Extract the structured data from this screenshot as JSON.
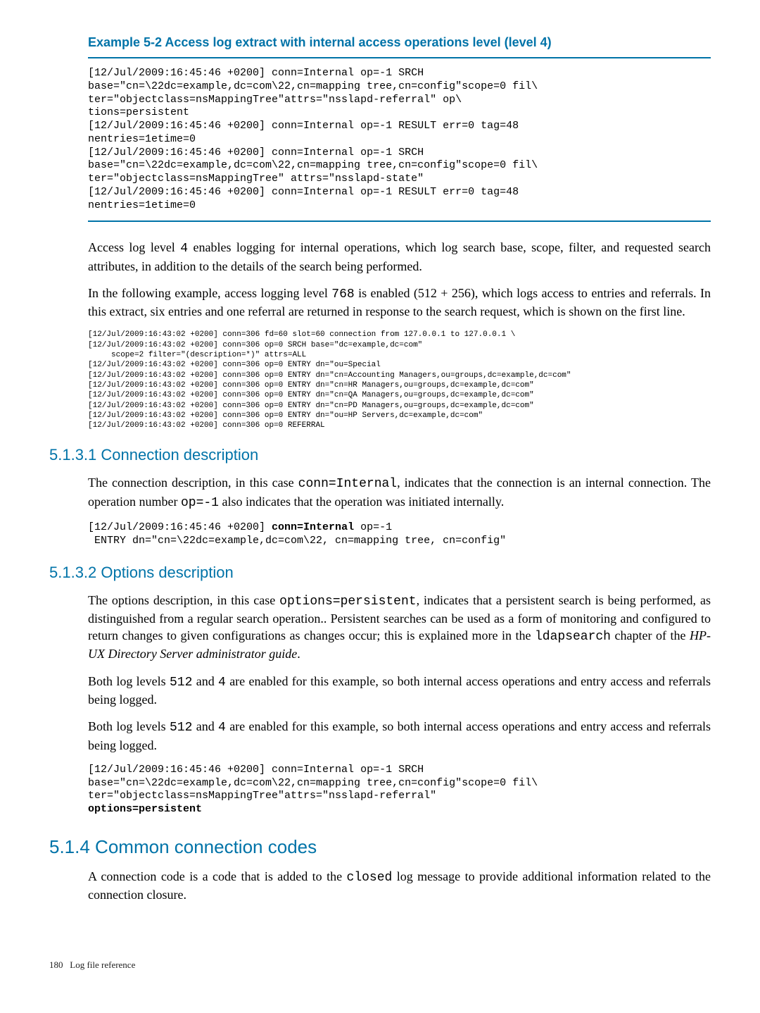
{
  "example": {
    "title": "Example 5-2 Access log extract with internal access operations level (level 4)",
    "code": "[12/Jul/2009:16:45:46 +0200] conn=Internal op=-1 SRCH\nbase=\"cn=\\22dc=example,dc=com\\22,cn=mapping tree,cn=config\"scope=0 fil\\\nter=\"objectclass=nsMappingTree\"attrs=\"nsslapd-referral\" op\\\ntions=persistent\n[12/Jul/2009:16:45:46 +0200] conn=Internal op=-1 RESULT err=0 tag=48\nnentries=1etime=0\n[12/Jul/2009:16:45:46 +0200] conn=Internal op=-1 SRCH\nbase=\"cn=\\22dc=example,dc=com\\22,cn=mapping tree,cn=config\"scope=0 fil\\\nter=\"objectclass=nsMappingTree\" attrs=\"nsslapd-state\"\n[12/Jul/2009:16:45:46 +0200] conn=Internal op=-1 RESULT err=0 tag=48\nnentries=1etime=0"
  },
  "para1a": "Access log level ",
  "para1code": "4",
  "para1b": " enables logging for internal operations, which log search base, scope, filter, and requested search attributes, in addition to the details of the search being performed.",
  "para2a": "In the following example, access logging level ",
  "para2code": "768",
  "para2b": " is enabled (512 + 256), which logs access to entries and referrals. In this extract, six entries and one referral are returned in response to the search request, which is shown on the first line.",
  "smallcode": "[12/Jul/2009:16:43:02 +0200] conn=306 fd=60 slot=60 connection from 127.0.0.1 to 127.0.0.1 \\\n[12/Jul/2009:16:43:02 +0200] conn=306 op=0 SRCH base=\"dc=example,dc=com\"\n     scope=2 filter=\"(description=*)\" attrs=ALL\n[12/Jul/2009:16:43:02 +0200] conn=306 op=0 ENTRY dn=\"ou=Special\n[12/Jul/2009:16:43:02 +0200] conn=306 op=0 ENTRY dn=\"cn=Accounting Managers,ou=groups,dc=example,dc=com\"\n[12/Jul/2009:16:43:02 +0200] conn=306 op=0 ENTRY dn=\"cn=HR Managers,ou=groups,dc=example,dc=com\"\n[12/Jul/2009:16:43:02 +0200] conn=306 op=0 ENTRY dn=\"cn=QA Managers,ou=groups,dc=example,dc=com\"\n[12/Jul/2009:16:43:02 +0200] conn=306 op=0 ENTRY dn=\"cn=PD Managers,ou=groups,dc=example,dc=com\"\n[12/Jul/2009:16:43:02 +0200] conn=306 op=0 ENTRY dn=\"ou=HP Servers,dc=example,dc=com\"\n[12/Jul/2009:16:43:02 +0200] conn=306 op=0 REFERRAL",
  "sec5131": {
    "title": "5.1.3.1 Connection description",
    "p_a": "The connection description, in this case ",
    "p_code1": "conn=Internal",
    "p_b": ", indicates that the connection is an internal connection. The operation number ",
    "p_code2": "op=-1",
    "p_c": " also indicates that the operation was initiated internally.",
    "code_pre": "[12/Jul/2009:16:45:46 +0200] ",
    "code_bold": "conn=Internal",
    "code_post": " op=-1\n ENTRY dn=\"cn=\\22dc=example,dc=com\\22, cn=mapping tree, cn=config\""
  },
  "sec5132": {
    "title": "5.1.3.2 Options description",
    "p1_a": "The options description, in this case ",
    "p1_code1": "options=persistent",
    "p1_b": ", indicates that a persistent search is being performed, as distinguished from a regular search operation.. Persistent searches can be used as a form of monitoring and configured to return changes to given configurations as changes occur; this is explained more in the ",
    "p1_code2": "ldapsearch",
    "p1_c": " chapter of the ",
    "p1_italic": "HP-UX Directory Server administrator guide",
    "p1_d": ".",
    "p2_a": "Both log levels ",
    "p2_code1": "512",
    "p2_b": " and ",
    "p2_code2": "4",
    "p2_c": " are enabled for this example, so both internal access operations and entry access and referrals being logged.",
    "p3_a": "Both log levels ",
    "p3_code1": "512",
    "p3_b": " and ",
    "p3_code2": "4",
    "p3_c": " are enabled for this example, so both internal access operations and entry access and referrals being logged.",
    "code2_pre": "[12/Jul/2009:16:45:46 +0200] conn=Internal op=-1 SRCH\nbase=\"cn=\\22dc=example,dc=com\\22,cn=mapping tree,cn=config\"scope=0 fil\\\nter=\"objectclass=nsMappingTree\"attrs=\"nsslapd-referral\"\n",
    "code2_bold": "options=persistent"
  },
  "sec514": {
    "title": "5.1.4 Common connection codes",
    "p_a": "A connection code is a code that is added to the ",
    "p_code": "closed",
    "p_b": " log message to provide additional information related to the connection closure."
  },
  "footer": {
    "page": "180",
    "text": "Log file reference"
  }
}
